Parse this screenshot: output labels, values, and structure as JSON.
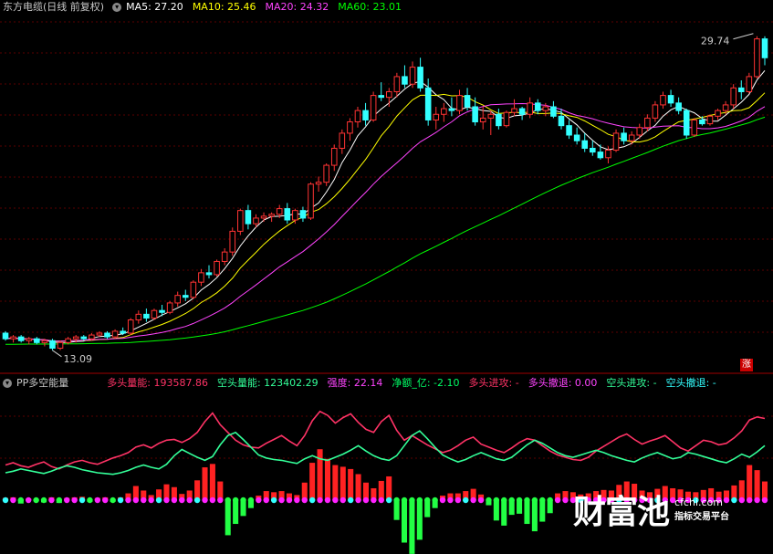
{
  "header": {
    "title": "东方电缆(日线 前复权)",
    "ma": [
      {
        "label": "MA5: 27.20",
        "color": "#ffffff"
      },
      {
        "label": "MA10: 25.46",
        "color": "#ffff00"
      },
      {
        "label": "MA20: 24.32",
        "color": "#ff44ff"
      },
      {
        "label": "MA60: 23.01",
        "color": "#00ff00"
      }
    ]
  },
  "indicator_header": {
    "name": "PP多空能量",
    "items": [
      {
        "label": "多头量能: 193587.86",
        "color": "#ff3366"
      },
      {
        "label": "空头量能: 123402.29",
        "color": "#33ff99"
      },
      {
        "label": "强度: 22.14",
        "color": "#ff44ff"
      },
      {
        "label": "净额_亿: -2.10",
        "color": "#00ff66"
      },
      {
        "label": "多头进攻: -",
        "color": "#ff3366"
      },
      {
        "label": "多头撤退: 0.00",
        "color": "#ff44ff"
      },
      {
        "label": "空头进攻: -",
        "color": "#33ff99"
      },
      {
        "label": "空头撤退: -",
        "color": "#33ffff"
      }
    ]
  },
  "annotations": {
    "high": "29.74",
    "low": "13.09",
    "limit_up_badge": "涨"
  },
  "watermark": {
    "big": "财富池",
    "url": "cfchi.com",
    "sub": "指标交易平台"
  },
  "chart_data": [
    {
      "type": "candlestick",
      "title": "东方电缆(日线 前复权)",
      "y_range": [
        12.5,
        30.5
      ],
      "up_color": "#ff3333",
      "down_color": "#33ffff",
      "candles": [
        [
          14.0,
          14.1,
          13.6,
          13.7
        ],
        [
          13.7,
          13.9,
          13.5,
          13.8
        ],
        [
          13.8,
          13.9,
          13.5,
          13.6
        ],
        [
          13.6,
          13.8,
          13.4,
          13.7
        ],
        [
          13.7,
          13.8,
          13.4,
          13.5
        ],
        [
          13.5,
          13.7,
          13.3,
          13.6
        ],
        [
          13.6,
          13.7,
          13.09,
          13.2
        ],
        [
          13.2,
          13.6,
          13.1,
          13.5
        ],
        [
          13.5,
          13.8,
          13.4,
          13.7
        ],
        [
          13.7,
          13.9,
          13.5,
          13.8
        ],
        [
          13.8,
          13.9,
          13.6,
          13.7
        ],
        [
          13.7,
          14.0,
          13.6,
          13.9
        ],
        [
          13.9,
          14.1,
          13.8,
          14.0
        ],
        [
          14.0,
          14.1,
          13.7,
          13.8
        ],
        [
          13.8,
          14.2,
          13.7,
          14.1
        ],
        [
          14.1,
          14.3,
          13.9,
          14.0
        ],
        [
          14.0,
          14.8,
          13.9,
          14.7
        ],
        [
          14.7,
          15.2,
          14.5,
          15.0
        ],
        [
          15.0,
          15.3,
          14.6,
          14.8
        ],
        [
          14.8,
          15.3,
          14.7,
          15.2
        ],
        [
          15.2,
          15.5,
          14.9,
          15.1
        ],
        [
          15.1,
          15.7,
          15.0,
          15.6
        ],
        [
          15.6,
          16.2,
          15.4,
          16.0
        ],
        [
          16.0,
          16.3,
          15.7,
          15.9
        ],
        [
          15.9,
          16.8,
          15.8,
          16.7
        ],
        [
          16.7,
          17.4,
          16.5,
          17.2
        ],
        [
          17.2,
          17.6,
          16.9,
          17.1
        ],
        [
          17.1,
          17.9,
          17.0,
          17.8
        ],
        [
          17.8,
          18.5,
          17.6,
          18.3
        ],
        [
          18.3,
          19.6,
          18.1,
          19.4
        ],
        [
          19.4,
          20.6,
          19.2,
          20.5
        ],
        [
          20.5,
          20.8,
          19.5,
          19.8
        ],
        [
          19.8,
          20.3,
          19.6,
          20.1
        ],
        [
          20.1,
          20.4,
          19.9,
          20.2
        ],
        [
          20.2,
          20.4,
          19.9,
          20.3
        ],
        [
          20.3,
          20.8,
          20.1,
          20.6
        ],
        [
          20.6,
          20.9,
          19.8,
          20.0
        ],
        [
          20.0,
          20.6,
          19.8,
          20.5
        ],
        [
          20.5,
          20.7,
          19.9,
          20.1
        ],
        [
          20.1,
          22.0,
          20.0,
          21.9
        ],
        [
          21.9,
          22.3,
          21.5,
          22.0
        ],
        [
          22.0,
          23.0,
          21.8,
          22.9
        ],
        [
          22.9,
          24.0,
          22.6,
          23.8
        ],
        [
          23.8,
          24.8,
          23.5,
          24.6
        ],
        [
          24.6,
          25.4,
          24.2,
          25.2
        ],
        [
          25.2,
          26.0,
          24.9,
          25.8
        ],
        [
          25.8,
          26.2,
          25.0,
          25.3
        ],
        [
          25.3,
          26.8,
          25.2,
          26.6
        ],
        [
          26.6,
          27.3,
          26.3,
          26.5
        ],
        [
          26.5,
          27.0,
          26.0,
          26.8
        ],
        [
          26.8,
          27.8,
          26.5,
          27.6
        ],
        [
          27.6,
          28.2,
          27.0,
          27.2
        ],
        [
          27.2,
          28.4,
          27.0,
          28.1
        ],
        [
          28.1,
          28.6,
          26.8,
          27.0
        ],
        [
          27.0,
          27.5,
          25.0,
          25.3
        ],
        [
          25.3,
          26.0,
          24.8,
          25.6
        ],
        [
          25.6,
          26.2,
          25.2,
          25.9
        ],
        [
          25.9,
          26.5,
          25.5,
          25.8
        ],
        [
          25.8,
          26.9,
          25.6,
          26.6
        ],
        [
          26.6,
          27.0,
          25.8,
          26.0
        ],
        [
          26.0,
          26.5,
          25.0,
          25.2
        ],
        [
          25.2,
          26.0,
          24.8,
          25.4
        ],
        [
          25.4,
          25.8,
          24.5,
          25.6
        ],
        [
          25.6,
          25.9,
          24.8,
          25.0
        ],
        [
          25.0,
          25.8,
          24.9,
          25.7
        ],
        [
          25.7,
          26.4,
          25.5,
          25.9
        ],
        [
          25.9,
          26.0,
          25.3,
          25.6
        ],
        [
          25.6,
          26.5,
          25.4,
          26.2
        ],
        [
          26.2,
          26.4,
          25.6,
          25.8
        ],
        [
          25.8,
          26.2,
          25.5,
          26.0
        ],
        [
          26.0,
          26.3,
          25.4,
          25.5
        ],
        [
          25.5,
          25.9,
          24.8,
          25.0
        ],
        [
          25.0,
          25.3,
          24.3,
          24.5
        ],
        [
          24.5,
          24.9,
          24.0,
          24.2
        ],
        [
          24.2,
          24.6,
          23.6,
          23.8
        ],
        [
          23.8,
          24.2,
          23.4,
          23.6
        ],
        [
          23.6,
          24.0,
          23.2,
          23.3
        ],
        [
          23.3,
          23.9,
          23.0,
          23.7
        ],
        [
          23.7,
          24.8,
          23.6,
          24.6
        ],
        [
          24.6,
          24.9,
          24.0,
          24.2
        ],
        [
          24.2,
          24.7,
          24.0,
          24.5
        ],
        [
          24.5,
          25.1,
          24.3,
          24.9
        ],
        [
          24.9,
          25.6,
          24.7,
          25.4
        ],
        [
          25.4,
          26.3,
          25.2,
          26.1
        ],
        [
          26.1,
          26.8,
          25.9,
          26.6
        ],
        [
          26.6,
          26.9,
          26.0,
          26.2
        ],
        [
          26.2,
          26.5,
          25.6,
          25.8
        ],
        [
          25.8,
          25.9,
          24.3,
          24.5
        ],
        [
          24.5,
          25.4,
          24.4,
          25.3
        ],
        [
          25.3,
          25.5,
          25.0,
          25.1
        ],
        [
          25.1,
          25.6,
          25.0,
          25.5
        ],
        [
          25.5,
          25.9,
          25.3,
          25.8
        ],
        [
          25.8,
          26.3,
          25.6,
          26.1
        ],
        [
          26.1,
          27.2,
          25.9,
          27.0
        ],
        [
          27.0,
          27.4,
          26.4,
          26.8
        ],
        [
          26.8,
          27.8,
          26.7,
          27.6
        ],
        [
          27.6,
          29.74,
          27.5,
          29.6
        ],
        [
          29.6,
          29.74,
          28.2,
          28.6
        ]
      ]
    },
    {
      "type": "line",
      "title": "PP多空能量",
      "series": [
        {
          "name": "多头量能",
          "color": "#ff3366",
          "values": [
            0.3,
            0.33,
            0.29,
            0.27,
            0.31,
            0.34,
            0.28,
            0.25,
            0.3,
            0.34,
            0.36,
            0.33,
            0.31,
            0.35,
            0.39,
            0.42,
            0.46,
            0.53,
            0.56,
            0.52,
            0.58,
            0.62,
            0.63,
            0.59,
            0.64,
            0.72,
            0.86,
            0.97,
            0.82,
            0.72,
            0.62,
            0.56,
            0.53,
            0.52,
            0.58,
            0.63,
            0.68,
            0.61,
            0.55,
            0.68,
            0.87,
            0.99,
            0.94,
            0.84,
            0.91,
            0.96,
            0.85,
            0.76,
            0.72,
            0.86,
            0.94,
            0.75,
            0.62,
            0.68,
            0.62,
            0.56,
            0.51,
            0.46,
            0.49,
            0.55,
            0.62,
            0.66,
            0.57,
            0.53,
            0.49,
            0.46,
            0.52,
            0.59,
            0.64,
            0.62,
            0.55,
            0.48,
            0.43,
            0.4,
            0.37,
            0.36,
            0.4,
            0.48,
            0.54,
            0.6,
            0.66,
            0.7,
            0.63,
            0.57,
            0.61,
            0.64,
            0.68,
            0.6,
            0.52,
            0.48,
            0.55,
            0.62,
            0.6,
            0.56,
            0.58,
            0.65,
            0.74,
            0.88,
            0.92,
            0.9
          ]
        },
        {
          "name": "空头量能",
          "color": "#33ff99",
          "values": [
            0.2,
            0.22,
            0.25,
            0.23,
            0.21,
            0.19,
            0.22,
            0.26,
            0.29,
            0.27,
            0.24,
            0.22,
            0.2,
            0.19,
            0.18,
            0.2,
            0.23,
            0.27,
            0.3,
            0.27,
            0.25,
            0.31,
            0.42,
            0.5,
            0.45,
            0.4,
            0.36,
            0.41,
            0.56,
            0.68,
            0.72,
            0.63,
            0.53,
            0.43,
            0.39,
            0.37,
            0.36,
            0.34,
            0.32,
            0.38,
            0.42,
            0.38,
            0.36,
            0.4,
            0.44,
            0.49,
            0.55,
            0.48,
            0.42,
            0.38,
            0.36,
            0.42,
            0.55,
            0.68,
            0.74,
            0.64,
            0.53,
            0.43,
            0.38,
            0.34,
            0.37,
            0.42,
            0.46,
            0.42,
            0.38,
            0.36,
            0.4,
            0.48,
            0.56,
            0.62,
            0.58,
            0.52,
            0.46,
            0.42,
            0.4,
            0.43,
            0.46,
            0.49,
            0.46,
            0.42,
            0.39,
            0.36,
            0.34,
            0.39,
            0.43,
            0.46,
            0.42,
            0.38,
            0.4,
            0.46,
            0.44,
            0.41,
            0.38,
            0.35,
            0.33,
            0.38,
            0.44,
            0.4,
            0.47,
            0.55
          ]
        },
        {
          "name": "净额",
          "type": "bar",
          "pos_color": "#ff2222",
          "neg_color": "#22ff44",
          "values": [
            0.04,
            0.05,
            -0.06,
            0.03,
            -0.02,
            -0.04,
            0.05,
            -0.05,
            0.04,
            0.05,
            0.06,
            -0.03,
            0.04,
            0.05,
            -0.03,
            0.05,
            0.12,
            0.25,
            0.17,
            0.09,
            0.19,
            0.28,
            0.23,
            0.11,
            0.17,
            0.35,
            0.58,
            0.64,
            0.33,
            -0.62,
            -0.42,
            -0.28,
            -0.14,
            0.08,
            0.16,
            0.14,
            0.16,
            0.12,
            0.09,
            0.31,
            0.66,
            0.9,
            0.73,
            0.62,
            0.59,
            0.55,
            0.46,
            0.31,
            0.21,
            0.34,
            0.42,
            -0.35,
            -0.75,
            -0.95,
            -0.7,
            -0.3,
            -0.14,
            0.08,
            0.12,
            0.12,
            0.16,
            0.2,
            0.1,
            -0.09,
            -0.36,
            -0.45,
            -0.26,
            -0.24,
            -0.42,
            -0.55,
            -0.38,
            -0.23,
            0.12,
            0.16,
            0.14,
            0.1,
            0.12,
            0.16,
            0.18,
            0.17,
            0.27,
            0.33,
            0.29,
            0.17,
            0.14,
            0.2,
            0.25,
            0.21,
            0.19,
            0.15,
            0.14,
            0.18,
            0.21,
            0.15,
            0.17,
            0.26,
            0.35,
            0.62,
            0.53,
            0.33
          ]
        }
      ]
    }
  ]
}
